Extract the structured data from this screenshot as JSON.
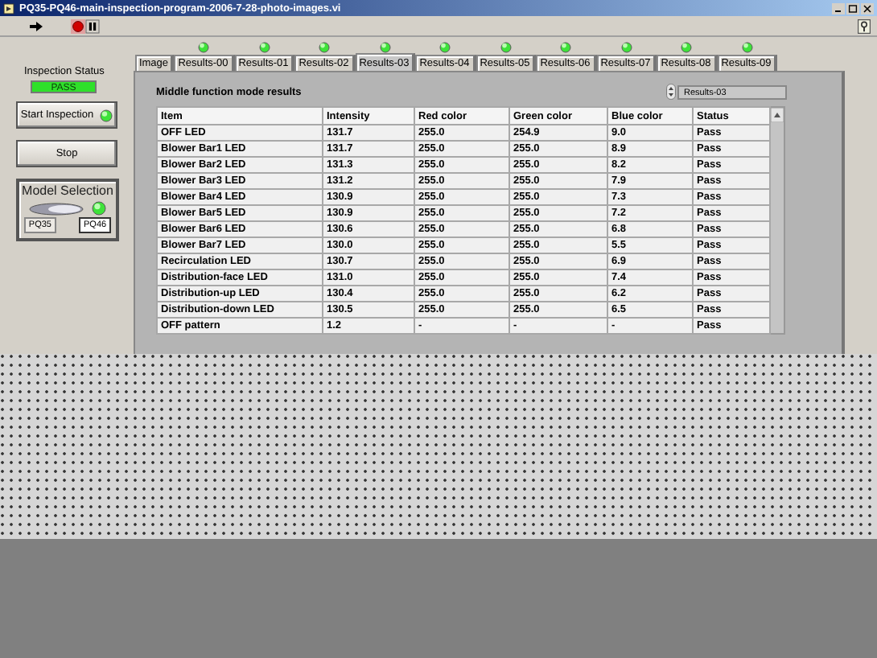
{
  "window": {
    "title": "PQ35-PQ46-main-inspection-program-2006-7-28-photo-images.vi"
  },
  "inspection_status": {
    "label": "Inspection Status",
    "value": "PASS",
    "passed": true
  },
  "buttons": [
    {
      "label": "Start Inspection",
      "kind": "led",
      "led_on": true
    },
    {
      "label": "Stop",
      "kind": "plain"
    }
  ],
  "model_selection": {
    "label": "Model Selection",
    "switch_on": true,
    "led_on": true,
    "options": [
      {
        "label": "PQ35",
        "selected": false
      },
      {
        "label": "PQ46",
        "selected": true
      }
    ]
  },
  "tabs": [
    {
      "label": "Image",
      "selected": false
    },
    {
      "label": "Results-00",
      "selected": false,
      "led_on": true
    },
    {
      "label": "Results-01",
      "selected": false,
      "led_on": true
    },
    {
      "label": "Results-02",
      "selected": false,
      "led_on": true
    },
    {
      "label": "Results-03",
      "selected": true,
      "led_on": true
    },
    {
      "label": "Results-04",
      "selected": false,
      "led_on": true
    },
    {
      "label": "Results-05",
      "selected": false,
      "led_on": true
    },
    {
      "label": "Results-06",
      "selected": false,
      "led_on": true
    },
    {
      "label": "Results-07",
      "selected": false,
      "led_on": true
    },
    {
      "label": "Results-08",
      "selected": false,
      "led_on": true
    },
    {
      "label": "Results-09",
      "selected": false,
      "led_on": true
    }
  ],
  "panel": {
    "title": "Middle function mode results",
    "selector": "Results-03"
  },
  "table": {
    "columns": [
      "Item",
      "Intensity",
      "Red color",
      "Green color",
      "Blue color",
      "Status"
    ],
    "rows": [
      [
        "OFF LED",
        "131.7",
        "255.0",
        "254.9",
        "9.0",
        "Pass"
      ],
      [
        "Blower Bar1 LED",
        "131.7",
        "255.0",
        "255.0",
        "8.9",
        "Pass"
      ],
      [
        "Blower Bar2 LED",
        "131.3",
        "255.0",
        "255.0",
        "8.2",
        "Pass"
      ],
      [
        "Blower Bar3 LED",
        "131.2",
        "255.0",
        "255.0",
        "7.9",
        "Pass"
      ],
      [
        "Blower Bar4 LED",
        "130.9",
        "255.0",
        "255.0",
        "7.3",
        "Pass"
      ],
      [
        "Blower Bar5 LED",
        "130.9",
        "255.0",
        "255.0",
        "7.2",
        "Pass"
      ],
      [
        "Blower Bar6 LED",
        "130.6",
        "255.0",
        "255.0",
        "6.8",
        "Pass"
      ],
      [
        "Blower Bar7 LED",
        "130.0",
        "255.0",
        "255.0",
        "5.5",
        "Pass"
      ],
      [
        "Recirculation LED",
        "130.7",
        "255.0",
        "255.0",
        "6.9",
        "Pass"
      ],
      [
        "Distribution-face LED",
        "131.0",
        "255.0",
        "255.0",
        "7.4",
        "Pass"
      ],
      [
        "Distribution-up LED",
        "130.4",
        "255.0",
        "255.0",
        "6.2",
        "Pass"
      ],
      [
        "Distribution-down LED",
        "130.5",
        "255.0",
        "255.0",
        "6.5",
        "Pass"
      ],
      [
        "OFF pattern",
        "1.2",
        "-",
        "-",
        "-",
        "Pass"
      ]
    ]
  }
}
